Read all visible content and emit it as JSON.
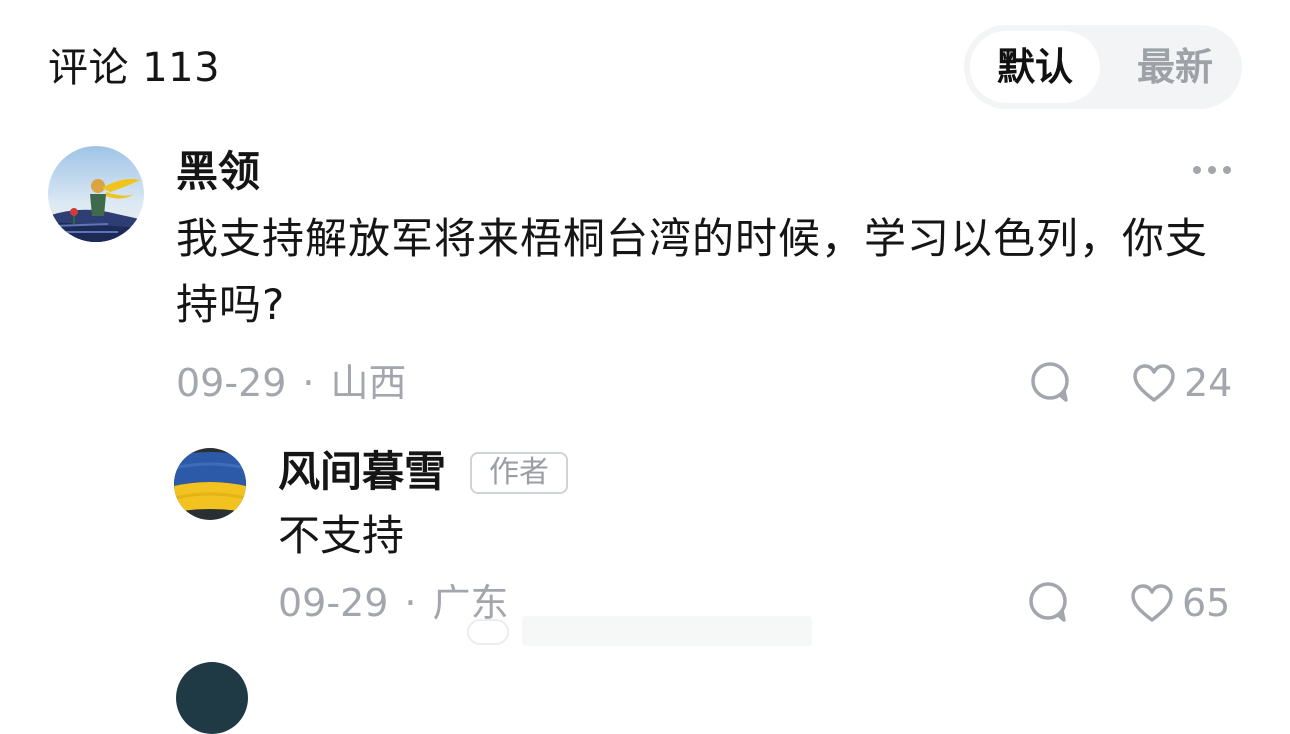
{
  "header": {
    "title": "评论 113",
    "sort_default": "默认",
    "sort_latest": "最新"
  },
  "comments": [
    {
      "username": "黑领",
      "text": "我支持解放军将来梧桐台湾的时候，学习以色列，你支持吗?",
      "date": "09-29",
      "location": "山西",
      "likes": "24",
      "replies": [
        {
          "username": "风间暮雪",
          "badge": "作者",
          "text": "不支持",
          "date": "09-29",
          "location": "广东",
          "likes": "65"
        }
      ]
    }
  ],
  "icons": {
    "more": "more-dots-icon",
    "reply": "comment-bubble-icon",
    "like": "heart-outline-icon"
  },
  "colors": {
    "text_primary": "#151515",
    "text_secondary": "#a3a7ad",
    "toggle_bg": "#f3f4f6"
  }
}
